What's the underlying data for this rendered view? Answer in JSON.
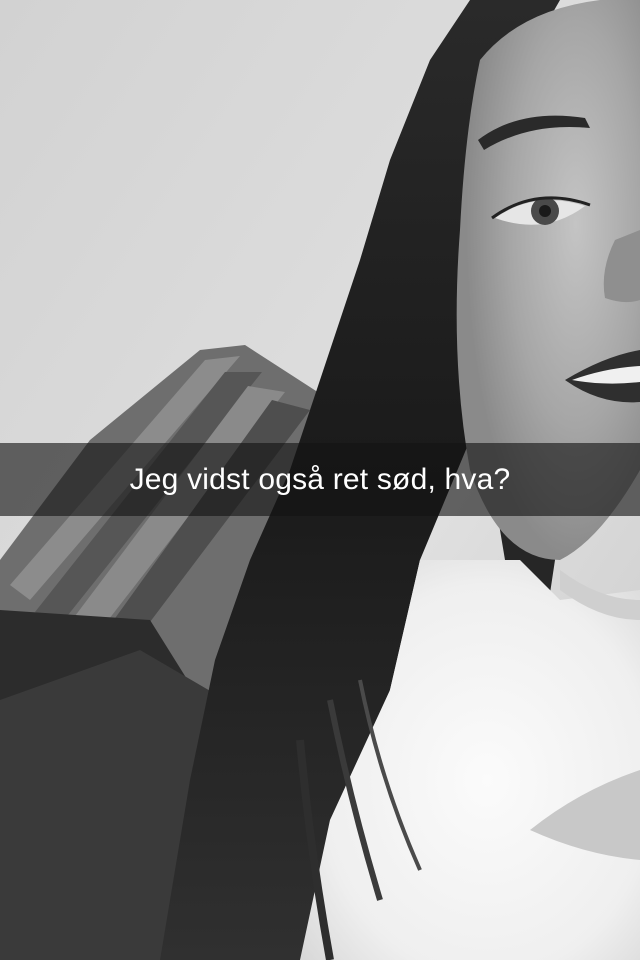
{
  "snap": {
    "caption": "Jeg vidst også ret sød, hva?"
  },
  "photo": {
    "style": "black-and-white selfie",
    "colors": {
      "wall": "#d9d9d9",
      "hair": "#1e1e1e",
      "skin": "#a9a9a9",
      "highlight": "#f2f2f2",
      "caption_bar": "#141414",
      "caption_text": "#ffffff"
    }
  }
}
